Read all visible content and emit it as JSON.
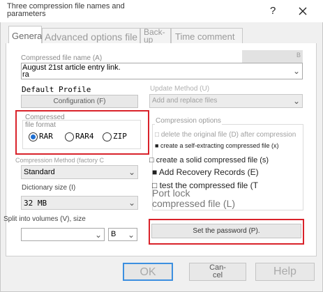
{
  "window": {
    "title": "Three compression file names and parameters",
    "help_symbol": "?",
    "close_symbol": "X"
  },
  "tabs": [
    {
      "label": "General"
    },
    {
      "label": "Advanced options file"
    },
    {
      "label": "Back-up"
    },
    {
      "label": "Time comment"
    }
  ],
  "general": {
    "archive_name_label": "Compressed file name (A)",
    "archive_name_value": "August 21st article entry link.\nra",
    "browse_label": "B",
    "default_profile_label": "Default Profile",
    "config_button": "Configuration (F)",
    "format_group_label": "Compressed\nfile format",
    "formats": [
      {
        "label": "RAR",
        "selected": true
      },
      {
        "label": "RAR4",
        "selected": false
      },
      {
        "label": "ZIP",
        "selected": false
      }
    ],
    "method_label": "Compression Method (factory C",
    "method_value": "Standard",
    "dict_label": "Dictionary size (I)",
    "dict_value": "32 MB",
    "volumes_label": "Split into volumes (V), size",
    "volumes_value": "",
    "volumes_unit": "B",
    "update_label": "Update Method (U)",
    "update_value": "Add and replace files",
    "options_group_label": "Compression options",
    "options": [
      {
        "label": "delete the original file (D) after compression",
        "checked": false
      },
      {
        "label": "create a self-extracting compressed file (x)",
        "checked": true
      },
      {
        "label": "create a solid compressed file (s)",
        "checked": false
      },
      {
        "label": "Add Recovery Records (E)",
        "checked": true
      },
      {
        "label": "test the compressed file (T",
        "checked": false
      },
      {
        "label": "Port lock compressed file (L)",
        "checked": false
      }
    ],
    "password_button": "Set the password (P)."
  },
  "footer": {
    "ok": "OK",
    "cancel": "Can-\ncel",
    "help": "Help"
  },
  "colors": {
    "highlight_red": "#d9222a",
    "focus_blue": "#3c8fe0"
  }
}
